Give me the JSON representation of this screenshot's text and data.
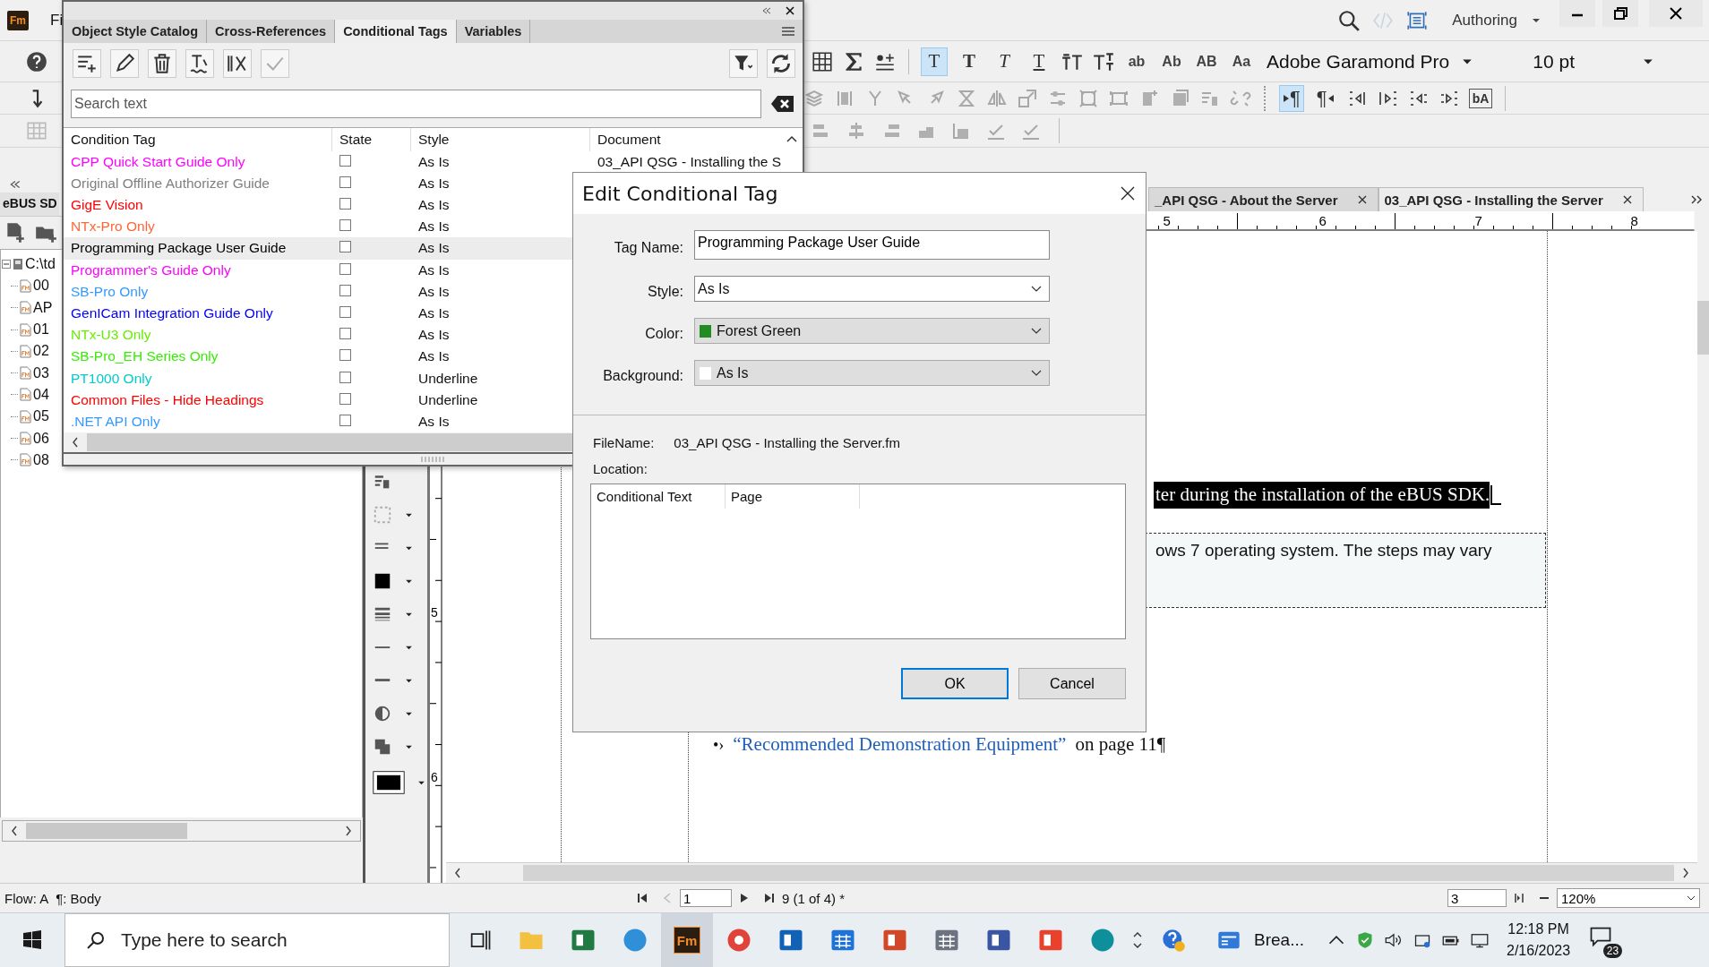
{
  "app": {
    "logo": "Fm",
    "menu_fragment": "Fi",
    "workspace": "Authoring"
  },
  "format_bar": {
    "char_buttons": [
      {
        "label": "T",
        "kind": "plain",
        "selected": true
      },
      {
        "label": "T",
        "kind": "bold",
        "selected": false
      },
      {
        "label": "T",
        "kind": "italic",
        "selected": false
      },
      {
        "label": "T",
        "kind": "underline",
        "selected": false
      },
      {
        "label": "ab",
        "kind": "case",
        "selected": false
      },
      {
        "label": "Ab",
        "kind": "case",
        "selected": false
      },
      {
        "label": "AB",
        "kind": "case",
        "selected": false
      },
      {
        "label": "Aa",
        "kind": "case",
        "selected": false
      }
    ],
    "font": "Adobe Garamond Pro",
    "size": "10 pt"
  },
  "paragraph_bar": {
    "direction_buttons": [
      {
        "label": "¶",
        "kind": "ltr",
        "selected": true
      },
      {
        "label": "¶",
        "kind": "rtl",
        "selected": false
      }
    ],
    "text_button": "bA"
  },
  "left_pane": {
    "tab": "eBUS SD",
    "tree": {
      "label": "C:\\td",
      "expanded": true,
      "children": [
        {
          "label": "00"
        },
        {
          "label": "AP"
        },
        {
          "label": "01"
        },
        {
          "label": "02"
        },
        {
          "label": "03"
        },
        {
          "label": "04"
        },
        {
          "label": "05"
        },
        {
          "label": "06"
        },
        {
          "label": "08"
        }
      ]
    }
  },
  "panel": {
    "tabs": [
      {
        "label": "Object Style Catalog",
        "selected": false
      },
      {
        "label": "Cross-References",
        "selected": false
      },
      {
        "label": "Conditional Tags",
        "selected": true
      },
      {
        "label": "Variables",
        "selected": false
      }
    ],
    "search": {
      "placeholder": "Search text"
    },
    "columns": [
      "Condition Tag",
      "State",
      "Style",
      "Document"
    ],
    "rows": [
      {
        "tag": "CPP Quick Start Guide Only",
        "color": "#ff00ff",
        "checked": false,
        "style": "As Is",
        "document": "03_API QSG - Installing the S",
        "selected": false
      },
      {
        "tag": "Original Offline Authorizer Guide",
        "color": "#808080",
        "checked": false,
        "style": "As Is",
        "selected": false
      },
      {
        "tag": "GigE Vision",
        "color": "#ff0000",
        "checked": false,
        "style": "As Is",
        "selected": false
      },
      {
        "tag": "NTx-Pro Only",
        "color": "#ff6633",
        "checked": false,
        "style": "As Is",
        "selected": false
      },
      {
        "tag": "Programming Package User Guide",
        "color": "#000000",
        "checked": false,
        "style": "As Is",
        "selected": true
      },
      {
        "tag": "Programmer's Guide Only",
        "color": "#ff00ff",
        "checked": false,
        "style": "As Is",
        "selected": false
      },
      {
        "tag": "SB-Pro Only",
        "color": "#3399ff",
        "checked": false,
        "style": "As Is",
        "selected": false
      },
      {
        "tag": "GenICam Integration Guide Only",
        "color": "#0000ff",
        "checked": false,
        "style": "As Is",
        "selected": false
      },
      {
        "tag": "NTx-U3 Only",
        "color": "#66ee00",
        "checked": false,
        "style": "As Is",
        "selected": false
      },
      {
        "tag": "SB-Pro_EH Series Only",
        "color": "#33ee00",
        "checked": false,
        "style": "As Is",
        "selected": false
      },
      {
        "tag": "PT1000 Only",
        "color": "#00cccc",
        "checked": false,
        "style": "Underline",
        "selected": false
      },
      {
        "tag": "Common Files - Hide Headings",
        "color": "#ff0000",
        "checked": false,
        "style": "Underline",
        "selected": false
      },
      {
        "tag": ".NET API Only",
        "color": "#3399ff",
        "checked": false,
        "style": "As Is",
        "selected": false
      }
    ]
  },
  "dialog": {
    "title": "Edit Conditional Tag",
    "fields": [
      {
        "label": "Tag Name:",
        "kind": "text",
        "value": "Programming Package User Guide"
      },
      {
        "label": "Style:",
        "kind": "select",
        "value": "As Is"
      },
      {
        "label": "Color:",
        "kind": "swatch",
        "value": "Forest Green",
        "color": "#228b22"
      },
      {
        "label": "Background:",
        "kind": "swatch",
        "value": "As Is",
        "color": "#ffffff"
      }
    ],
    "filename_label": "FileName:",
    "filename": "03_API QSG - Installing the Server.fm",
    "location_label": "Location:",
    "location_columns": [
      "Conditional Text",
      "Page"
    ],
    "buttons": [
      {
        "label": "OK",
        "kind": "default"
      },
      {
        "label": "Cancel",
        "kind": "normal"
      }
    ]
  },
  "document": {
    "tabs": [
      {
        "label": "_API QSG - About the Server",
        "selected": false
      },
      {
        "label": "03_API QSG - Installing the Server",
        "selected": true
      }
    ],
    "hruler": [
      "5",
      "6",
      "7",
      "8"
    ],
    "vruler": [
      "5",
      "6"
    ],
    "selected_text": "ter during the installation of the eBUS SDK.",
    "note_text": "ows 7 operating system. The steps may vary",
    "bullet": "•›",
    "link": "“Recommended Demonstration Equipment”",
    "link_tail": "on page 11¶"
  },
  "status_bar": {
    "flow": "Flow: A",
    "paragraph": "¶: Body",
    "page_field": "1",
    "page_info": "9 (1 of 4) *",
    "field_3": "3",
    "zoom": "120%"
  },
  "taskbar": {
    "search_placeholder": "Type here to search",
    "apps": [
      {
        "kind": "folder",
        "active": false
      },
      {
        "kind": "sheet",
        "active": false
      },
      {
        "kind": "globe-e",
        "active": false
      },
      {
        "kind": "fm",
        "label": "Fm",
        "active": true
      },
      {
        "kind": "wheel",
        "active": false
      },
      {
        "kind": "mail",
        "active": false
      },
      {
        "kind": "calendar",
        "active": false
      },
      {
        "kind": "slides",
        "active": false
      },
      {
        "kind": "calculator",
        "active": false
      },
      {
        "kind": "diagram",
        "active": false
      },
      {
        "kind": "s-tile",
        "active": false
      },
      {
        "kind": "wave",
        "active": false
      }
    ],
    "news": "Brea...",
    "time": "12:18 PM",
    "date": "2/16/2023",
    "notifications": "23"
  }
}
